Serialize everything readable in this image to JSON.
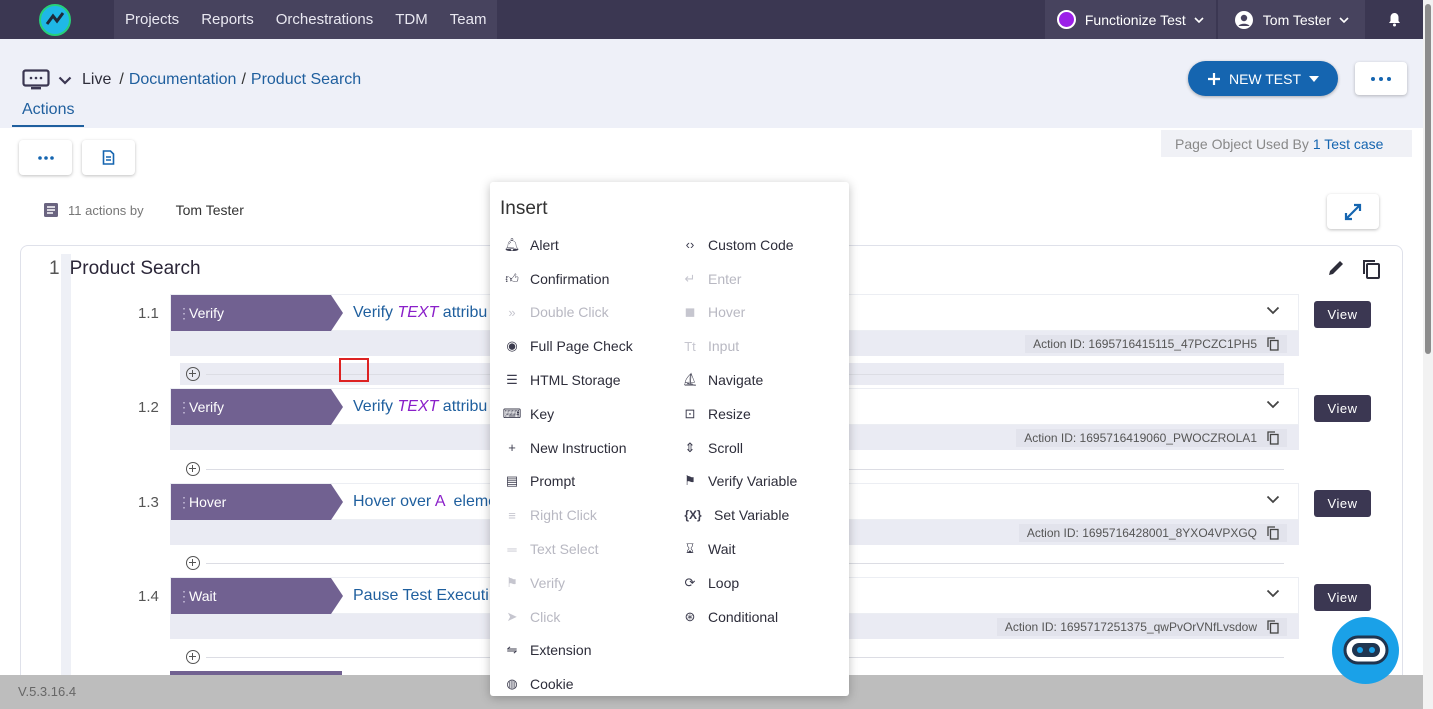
{
  "nav": {
    "links": [
      "Projects",
      "Reports",
      "Orchestrations",
      "TDM",
      "Team"
    ],
    "org": "Functionize Test",
    "user": "Tom Tester"
  },
  "header": {
    "crumb_live": "Live",
    "crumb_doc": "Documentation",
    "crumb_page": "Product Search",
    "sep": "/",
    "tab": "Actions",
    "new_test": "NEW TEST"
  },
  "pageobj": {
    "text": "Page Object Used By",
    "link": "1 Test case"
  },
  "meta": {
    "count": "11 actions by",
    "user": "Tom Tester"
  },
  "card": {
    "num": "1",
    "title": "Product Search"
  },
  "steps": [
    {
      "num": "1.1",
      "tag": "Verify",
      "pre": "Verify ",
      "em": "TEXT",
      "post": " attribu",
      "id": "Action ID: 1695716415115_47PCZC1PH5",
      "view": "View"
    },
    {
      "num": "1.2",
      "tag": "Verify",
      "pre": "Verify ",
      "em": "TEXT",
      "post": " attribu",
      "id": "Action ID: 1695716419060_PWOCZROLA1",
      "view": "View"
    },
    {
      "num": "1.3",
      "tag": "Hover",
      "pre": "Hover over ",
      "em": "A",
      "post": "  eleme",
      "id": "Action ID: 1695716428001_8YXO4VPXGQ",
      "view": "View"
    },
    {
      "num": "1.4",
      "tag": "Wait",
      "pre": "Pause Test Executi",
      "em": "",
      "post": "",
      "id": "Action ID: 1695717251375_qwPvOrVNfLvsdow",
      "view": "View"
    }
  ],
  "insert": {
    "title": "Insert",
    "left": [
      "Alert",
      "Confirmation",
      "Double Click",
      "Full Page Check",
      "HTML Storage",
      "Key",
      "New Instruction",
      "Prompt",
      "Right Click",
      "Text Select",
      "Verify",
      "Click",
      "Extension",
      "Cookie"
    ],
    "right": [
      "Custom Code",
      "Enter",
      "Hover",
      "Input",
      "Navigate",
      "Resize",
      "Scroll",
      "Verify Variable",
      "Set Variable",
      "Wait",
      "Loop",
      "Conditional"
    ],
    "left_icons": [
      "bell-icon",
      "thumbs-icon",
      "double-chevron-icon",
      "eye-icon",
      "storage-icon",
      "keyboard-icon",
      "plus-icon",
      "prompt-icon",
      "right-click-icon",
      "text-select-icon",
      "flag-icon",
      "cursor-icon",
      "extension-icon",
      "cookie-icon"
    ],
    "right_icons": [
      "code-icon",
      "enter-icon",
      "mouse-icon",
      "text-input-icon",
      "ship-icon",
      "resize-icon",
      "scroll-icon",
      "flag-icon",
      "variable-icon",
      "hourglass-icon",
      "loop-icon",
      "share-icon"
    ],
    "setvar_glyph": "{X}",
    "disabled_left": [
      2,
      8,
      9,
      10,
      11
    ],
    "disabled_right": [
      1,
      2,
      3
    ]
  },
  "footer": {
    "version": "V.5.3.16.4"
  },
  "colors": {
    "nav": "#3b3752",
    "accent": "#1565b0",
    "tag": "#716191",
    "link": "#1f5f9e"
  }
}
